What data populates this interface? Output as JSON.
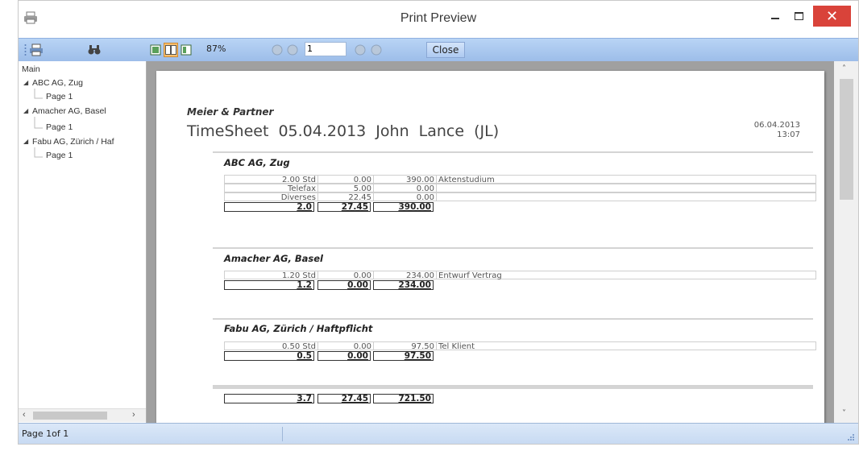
{
  "window": {
    "title": "Print Preview"
  },
  "toolbar": {
    "zoom": "87%",
    "page_value": "1",
    "close_label": "Close"
  },
  "tree": {
    "root": "Main",
    "nodes": [
      {
        "label": "ABC AG, Zug",
        "page": "Page 1"
      },
      {
        "label": "Amacher AG, Basel",
        "page": "Page 1"
      },
      {
        "label": "Fabu AG, Zürich / Haf",
        "page": "Page 1"
      }
    ]
  },
  "report": {
    "company": "Meier & Partner",
    "title": "TimeSheet  05.04.2013  John Lance (JL)",
    "date": "06.04.2013",
    "time": "13:07",
    "clients": [
      {
        "name": "ABC AG, Zug",
        "rows": [
          {
            "c1": "2.00 Std",
            "c2": "0.00",
            "c3": "390.00",
            "c4": "Aktenstudium"
          },
          {
            "c1": "Telefax",
            "c2": "5.00",
            "c3": "0.00",
            "c4": ""
          },
          {
            "c1": "Diverses",
            "c2": "22.45",
            "c3": "0.00",
            "c4": ""
          }
        ],
        "total": {
          "c1": "2.0",
          "c2": "27.45",
          "c3": "390.00"
        }
      },
      {
        "name": "Amacher AG, Basel",
        "rows": [
          {
            "c1": "1.20 Std",
            "c2": "0.00",
            "c3": "234.00",
            "c4": "Entwurf Vertrag"
          }
        ],
        "total": {
          "c1": "1.2",
          "c2": "0.00",
          "c3": "234.00"
        }
      },
      {
        "name": "Fabu AG, Zürich / Haftpflicht",
        "rows": [
          {
            "c1": "0.50 Std",
            "c2": "0.00",
            "c3": "97.50",
            "c4": "Tel Klient"
          }
        ],
        "total": {
          "c1": "0.5",
          "c2": "0.00",
          "c3": "97.50"
        }
      }
    ],
    "grand_total": {
      "c1": "3.7",
      "c2": "27.45",
      "c3": "721.50"
    }
  },
  "status": {
    "page_info": "Page 1of 1"
  },
  "colors": {
    "toolbar": "#a9c8ef",
    "close_button": "#d9433a",
    "preview_bg": "#a0a0a0"
  }
}
